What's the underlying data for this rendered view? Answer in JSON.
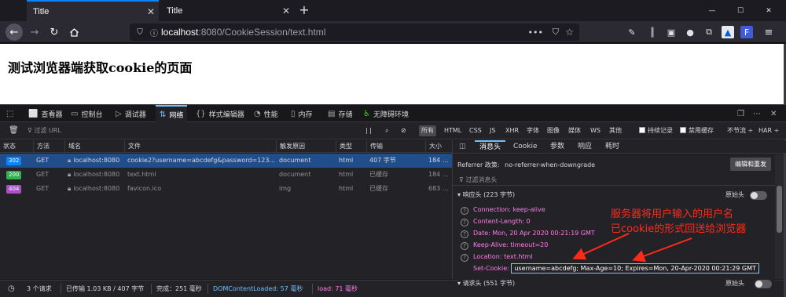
{
  "tabs": [
    {
      "title": "Title",
      "active": true
    },
    {
      "title": "Title",
      "active": false
    }
  ],
  "window_controls": {
    "minimize": "—",
    "maximize": "☐",
    "close": "✕"
  },
  "url": {
    "host": "localhost",
    "rest": ":8080/CookieSession/text.html"
  },
  "page": {
    "heading": "测试浏览器端获取cookie的页面"
  },
  "devtools": {
    "tabs": [
      "查看器",
      "控制台",
      "调试器",
      "网络",
      "样式编辑器",
      "性能",
      "内存",
      "存储",
      "无障碍环境"
    ],
    "selected_tab": "网络",
    "filter_placeholder": "过滤 URL",
    "pause_label": "| |",
    "type_filters": [
      "所有",
      "HTML",
      "CSS",
      "JS",
      "XHR",
      "字体",
      "图像",
      "媒体",
      "WS",
      "其他"
    ],
    "persist_log": "持续记录",
    "disable_cache": "禁用缓存",
    "throttling": "不节流 ÷",
    "har": "HAR ÷",
    "columns": [
      "状态",
      "方法",
      "域名",
      "文件",
      "触发原因",
      "类型",
      "传输",
      "大小"
    ],
    "requests": [
      {
        "status": "302",
        "status_color": "#0a84ff",
        "method": "GET",
        "domain": "localhost:8080",
        "file": "cookie2?username=abcdefg&password=123...",
        "cause": "document",
        "type": "html",
        "transferred": "407 字节",
        "size": "184 ..."
      },
      {
        "status": "200",
        "status_color": "#30b04e",
        "method": "GET",
        "domain": "localhost:8080",
        "file": "text.html",
        "cause": "document",
        "type": "html",
        "transferred": "已缓存",
        "size": "184 ..."
      },
      {
        "status": "404",
        "status_color": "#a952c7",
        "method": "GET",
        "domain": "localhost:8080",
        "file": "favicon.ico",
        "cause": "img",
        "type": "html",
        "transferred": "已缓存",
        "size": "683 ..."
      }
    ],
    "detail_tabs": [
      "消息头",
      "Cookie",
      "参数",
      "响应",
      "耗时"
    ],
    "selected_detail_tab": "消息头",
    "referrer_policy_label": "Referrer 政策:",
    "referrer_policy_value": "no-referrer-when-downgrade",
    "edit_resend": "编辑和重发",
    "filter_headers": "过滤消息头",
    "response_headers_label": "响应头 (223 字节)",
    "raw_headers": "原始头",
    "response_headers": [
      {
        "name": "Connection:",
        "value": "keep-alive"
      },
      {
        "name": "Content-Length:",
        "value": "0"
      },
      {
        "name": "Date:",
        "value": "Mon, 20 Apr 2020 00:21:19 GMT"
      },
      {
        "name": "Keep-Alive:",
        "value": "timeout=20"
      },
      {
        "name": "Location:",
        "value": "text.html"
      }
    ],
    "set_cookie": {
      "name": "Set-Cookie:",
      "value": "username=abcdefg; Max-Age=10; Expires=Mon, 20-Apr-2020 00:21:29 GMT"
    },
    "request_headers_label": "请求头 (551 字节)",
    "status": {
      "requests": "3 个请求",
      "transferred": "已传输 1.03 KB / 407 字节",
      "finish": "完成：251 毫秒",
      "dom_loaded": "DOMContentLoaded: 57 毫秒",
      "load": "load: 71 毫秒"
    }
  },
  "annotation": {
    "line1": "服务器将用户输入的用户名",
    "line2": "已cookie的形式回送给浏览器",
    "color": "#ff2a1a"
  }
}
